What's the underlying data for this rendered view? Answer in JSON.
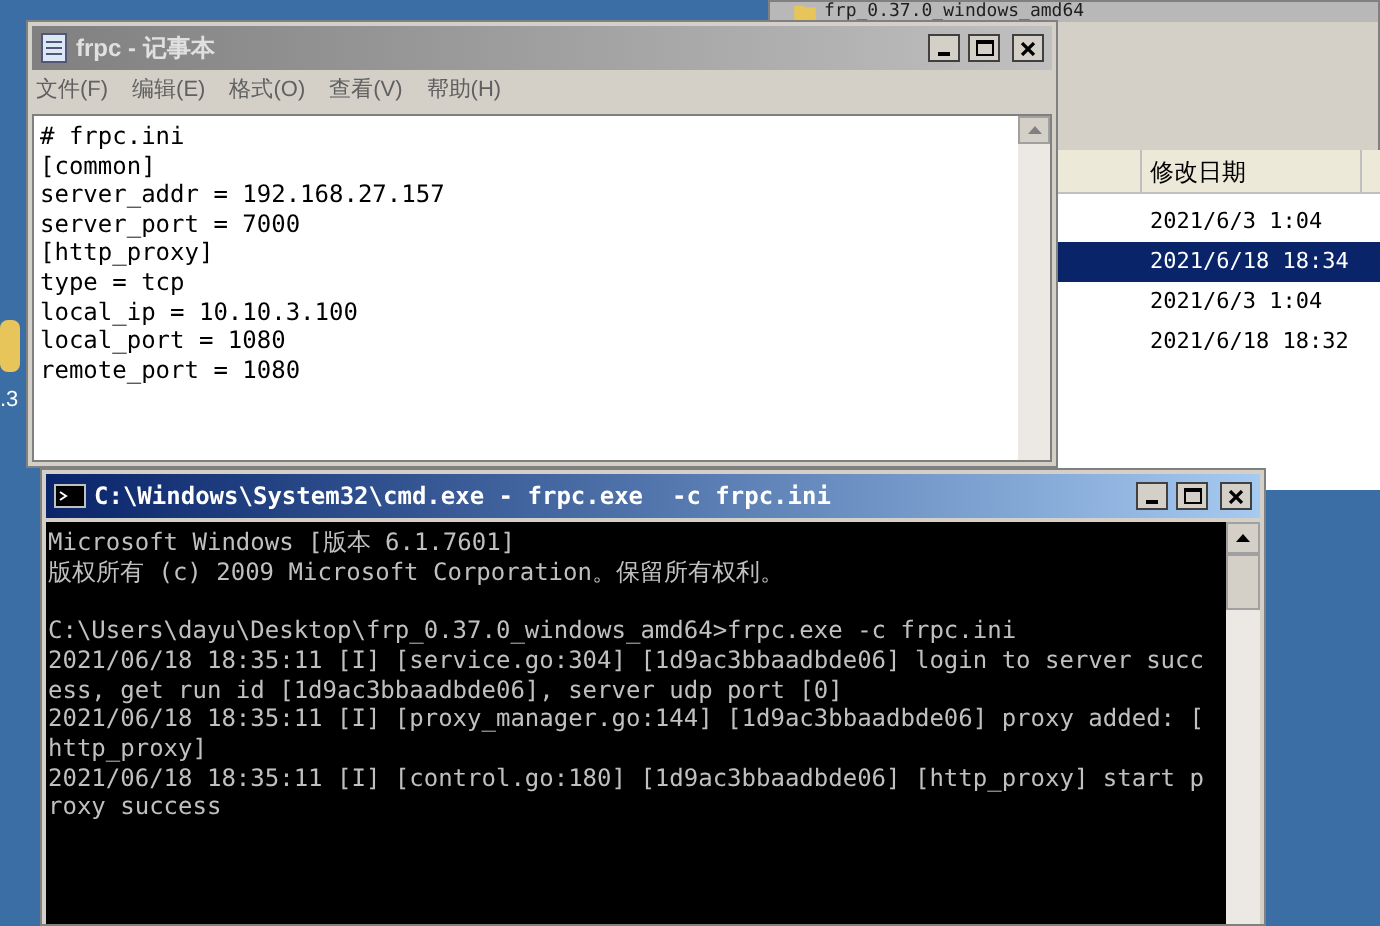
{
  "desktop": {
    "icon_label": ".3"
  },
  "explorer": {
    "title": "frp_0.37.0_windows_amd64",
    "column": "修改日期",
    "rows": [
      {
        "date": "2021/6/3 1:04",
        "selected": false
      },
      {
        "date": "2021/6/18 18:34",
        "selected": true
      },
      {
        "date": "2021/6/3 1:04",
        "selected": false
      },
      {
        "date": "2021/6/18 18:32",
        "selected": false
      }
    ]
  },
  "notepad": {
    "title": "frpc - 记事本",
    "menu": [
      "文件(F)",
      "编辑(E)",
      "格式(O)",
      "查看(V)",
      "帮助(H)"
    ],
    "lines": [
      "# frpc.ini",
      "[common]",
      "server_addr = 192.168.27.157",
      "server_port = 7000",
      "[http_proxy]",
      "type = tcp",
      "local_ip = 10.10.3.100",
      "local_port = 1080",
      "remote_port = 1080"
    ]
  },
  "cmd": {
    "title": "C:\\Windows\\System32\\cmd.exe - frpc.exe  -c frpc.ini",
    "paragraphs": [
      [
        "Microsoft Windows [版本 6.1.7601]",
        "版权所有 (c) 2009 Microsoft Corporation。保留所有权利。"
      ],
      [
        "C:\\Users\\dayu\\Desktop\\frp_0.37.0_windows_amd64>frpc.exe -c frpc.ini",
        "2021/06/18 18:35:11 [I] [service.go:304] [1d9ac3bbaadbde06] login to server succ",
        "ess, get run id [1d9ac3bbaadbde06], server udp port [0]",
        "2021/06/18 18:35:11 [I] [proxy_manager.go:144] [1d9ac3bbaadbde06] proxy added: [",
        "http_proxy]",
        "2021/06/18 18:35:11 [I] [control.go:180] [1d9ac3bbaadbde06] [http_proxy] start p",
        "roxy success"
      ]
    ]
  }
}
